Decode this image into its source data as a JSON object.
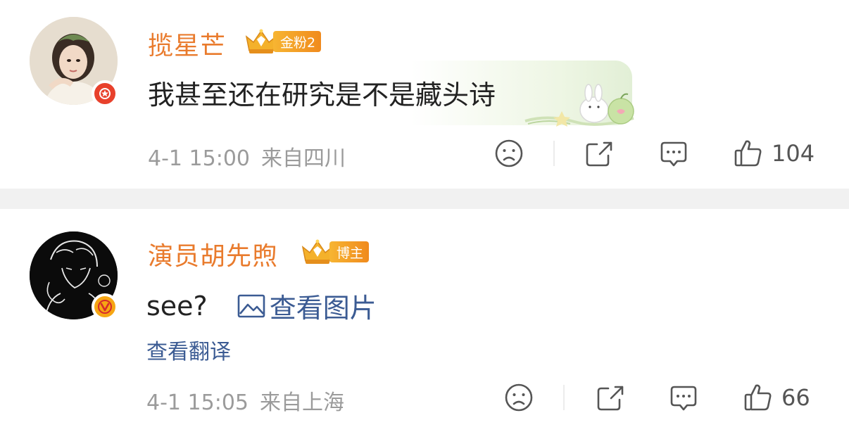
{
  "comments": [
    {
      "username": "揽星芒",
      "fan_badge": "金粉2",
      "text": "我甚至还在研究是不是藏头诗",
      "time": "4-1 15:00",
      "location": "来自四川",
      "like_count": "104",
      "avatar_badge_icon": "star-icon"
    },
    {
      "username": "演员胡先煦",
      "fan_badge": "博主",
      "text": "see?",
      "view_image_label": "查看图片",
      "translate_label": "查看翻译",
      "time": "4-1 15:05",
      "location": "来自上海",
      "like_count": "66",
      "avatar_badge_icon": "verified-v-icon"
    }
  ],
  "colors": {
    "username": "#e97b2d",
    "link": "#3b5b93",
    "meta": "#9b9b9b",
    "separator": "#f1f1f1",
    "badge_gold": "#f6a613",
    "badge_red": "#e8412c"
  },
  "icons": {
    "dislike": "sad-face-icon",
    "share": "share-icon",
    "comment": "comment-icon",
    "like": "thumbs-up-icon"
  }
}
